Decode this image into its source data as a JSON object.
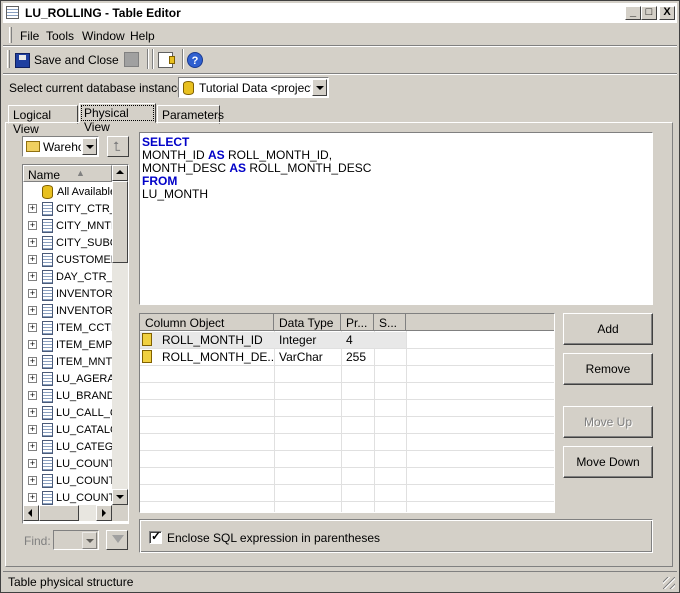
{
  "window": {
    "title": "LU_ROLLING - Table Editor",
    "controls": {
      "minimize": "_",
      "maximize": "□",
      "close": "X"
    }
  },
  "menu": [
    "File",
    "Tools",
    "Window",
    "Help"
  ],
  "toolbar": {
    "save_close": "Save and Close"
  },
  "instance": {
    "label": "Select current database instance",
    "value": "Tutorial Data <project p"
  },
  "tabs": [
    "Logical View",
    "Physical View",
    "Parameters"
  ],
  "tree": {
    "source": "Wareho",
    "header": "Name",
    "all_label": "All Available",
    "items": [
      "CITY_CTR_",
      "CITY_MNTH",
      "CITY_SUBC",
      "CUSTOMER",
      "DAY_CTR_S",
      "INVENTORY",
      "INVENTORY",
      "ITEM_CCTF",
      "ITEM_EMP_",
      "ITEM_MNTH",
      "LU_AGERAN",
      "LU_BRAND",
      "LU_CALL_C",
      "LU_CATALO",
      "LU_CATEGO",
      "LU_COUNTI",
      "LU_COUNTI",
      "LU_COUNTI"
    ]
  },
  "find": {
    "label": "Find:"
  },
  "sql": {
    "lines": [
      [
        {
          "t": "SELECT",
          "kw": true
        }
      ],
      [
        {
          "t": "MONTH_ID ",
          "kw": false
        },
        {
          "t": "AS",
          "kw": true
        },
        {
          "t": " ROLL_MONTH_ID,",
          "kw": false
        }
      ],
      [
        {
          "t": "MONTH_DESC ",
          "kw": false
        },
        {
          "t": "AS",
          "kw": true
        },
        {
          "t": " ROLL_MONTH_DESC",
          "kw": false
        }
      ],
      [
        {
          "t": "FROM",
          "kw": true
        }
      ],
      [
        {
          "t": "LU_MONTH",
          "kw": false
        }
      ]
    ]
  },
  "columns": {
    "headers": [
      "Column Object",
      "Data Type",
      "Pr...",
      "S..."
    ],
    "rows": [
      {
        "name": "ROLL_MONTH_ID",
        "type": "Integer",
        "precision": "4",
        "scale": ""
      },
      {
        "name": "ROLL_MONTH_DE...",
        "type": "VarChar",
        "precision": "255",
        "scale": ""
      }
    ]
  },
  "buttons": {
    "add": "Add",
    "remove": "Remove",
    "move_up": "Move Up",
    "move_down": "Move Down"
  },
  "enclose": {
    "label": "Enclose SQL expression in parentheses",
    "checked": true
  },
  "status": "Table physical structure"
}
